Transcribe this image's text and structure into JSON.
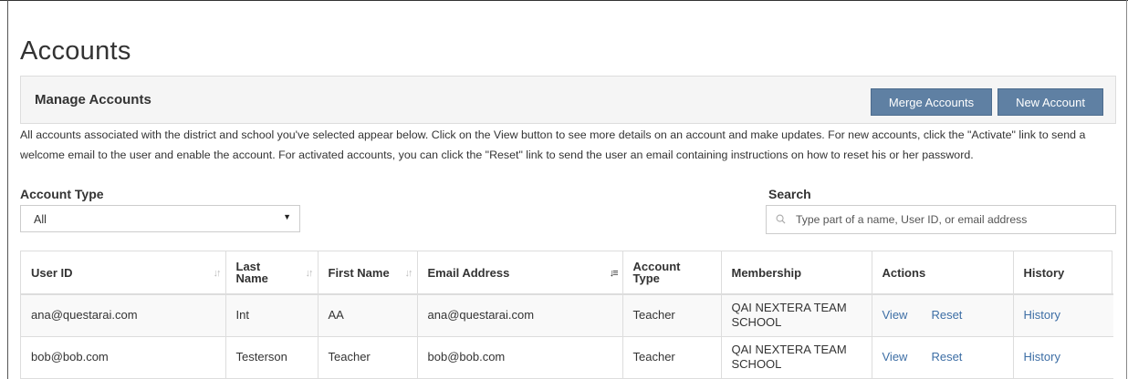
{
  "page": {
    "title": "Accounts"
  },
  "panel": {
    "title": "Manage Accounts",
    "merge_label": "Merge Accounts",
    "new_label": "New Account"
  },
  "description": "All accounts associated with the district and school you've selected appear below. Click on the View button to see more details on an account and make updates. For new accounts, click the \"Activate\" link to send a welcome email to the user and enable the account. For activated accounts, you can click the \"Reset\" link to send the user an email containing instructions on how to reset his or her password.",
  "filters": {
    "account_type_label": "Account Type",
    "account_type_value": "All",
    "search_label": "Search",
    "search_placeholder": "Type part of a name, User ID, or email address"
  },
  "table": {
    "columns": {
      "user_id": "User ID",
      "last_name": "Last Name",
      "first_name": "First Name",
      "email": "Email Address",
      "account_type": "Account Type",
      "membership": "Membership",
      "actions": "Actions",
      "history": "History"
    },
    "rows": [
      {
        "user_id": "ana@questarai.com",
        "last_name": "Int",
        "first_name": "AA",
        "email": "ana@questarai.com",
        "account_type": "Teacher",
        "membership": "QAI NEXTERA TEAM SCHOOL",
        "view": "View",
        "reset": "Reset",
        "history": "History"
      },
      {
        "user_id": "bob@bob.com",
        "last_name": "Testerson",
        "first_name": "Teacher",
        "email": "bob@bob.com",
        "account_type": "Teacher",
        "membership": "QAI NEXTERA TEAM SCHOOL",
        "view": "View",
        "reset": "Reset",
        "history": "History"
      }
    ]
  },
  "colors": {
    "button_bg": "#5f80a3",
    "link": "#3d6ea5",
    "panel_bg": "#f5f5f5",
    "border": "#dddddd"
  },
  "icons": {
    "search": "search-icon",
    "sort": "sort-icon",
    "dropdown": "caret-down-icon"
  }
}
